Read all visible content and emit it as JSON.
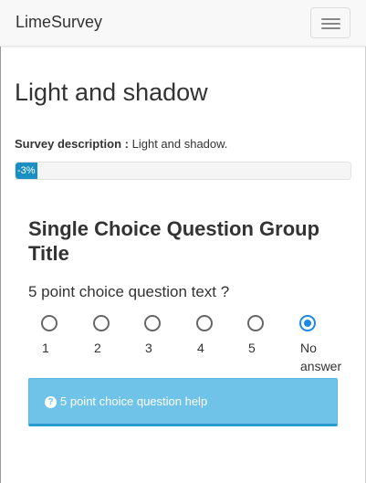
{
  "navbar": {
    "brand": "LimeSurvey",
    "menu_toggle_icon": "hamburger-icon"
  },
  "survey": {
    "title": "Light and shadow",
    "description_label": "Survey description :",
    "description": "Light and shadow."
  },
  "progress": {
    "label": "-3%",
    "value_percent": -3
  },
  "group": {
    "title": "Single Choice Question Group Title"
  },
  "question": {
    "text": "5 point choice question text ?",
    "choices": [
      {
        "label": "1",
        "checked": false
      },
      {
        "label": "2",
        "checked": false
      },
      {
        "label": "3",
        "checked": false
      },
      {
        "label": "4",
        "checked": false
      },
      {
        "label": "5",
        "checked": false
      },
      {
        "label": "No answer",
        "checked": true
      }
    ],
    "help": {
      "icon": "question-circle-icon",
      "text": "5 point choice question help"
    }
  },
  "colors": {
    "accent": "#1e88e5",
    "progress": "#1a8fc4",
    "help_background": "#6fc3e8"
  }
}
